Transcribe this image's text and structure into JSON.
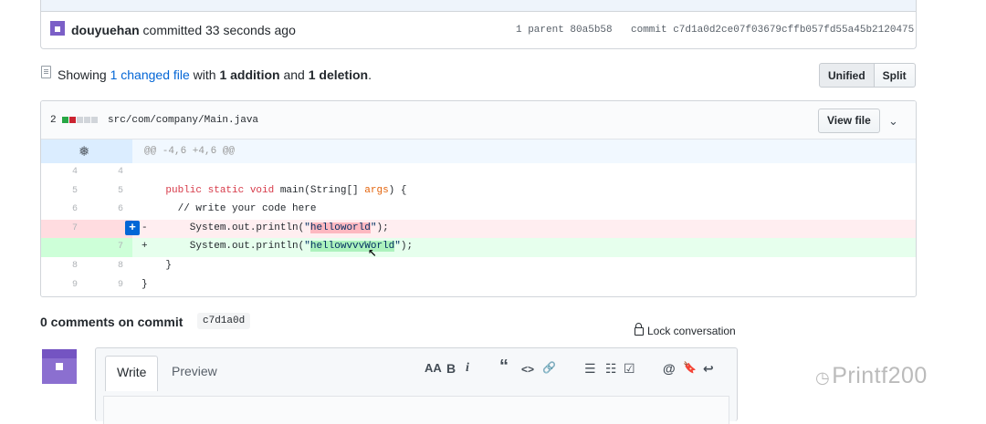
{
  "commit": {
    "author": "douyuehan",
    "action": " committed 33 seconds ago",
    "parent": "1 parent 80a5b58",
    "sha": "commit c7d1a0d2ce07f03679cffb057fd55a45b2120475"
  },
  "summary": {
    "prefix": "Showing ",
    "changed": "1 changed file",
    "mid1": " with ",
    "additions": "1 addition",
    "mid2": " and ",
    "deletions": "1 deletion",
    "suffix": "."
  },
  "view_buttons": {
    "unified": "Unified",
    "split": "Split"
  },
  "file": {
    "count": "2",
    "path": "src/com/company/Main.java",
    "view_file": "View file",
    "hunk": "@@ -4,6 +4,6 @@",
    "lines": [
      {
        "old": "4",
        "new": "4",
        "kind": "ctx",
        "text": ""
      },
      {
        "old": "5",
        "new": "5",
        "kind": "ctx",
        "text": "    public static void main(String[] args) {"
      },
      {
        "old": "6",
        "new": "6",
        "kind": "ctx",
        "text": "      // write your code here"
      },
      {
        "old": "7",
        "new": "",
        "kind": "del",
        "text": "        System.out.println(\"helloworld\");"
      },
      {
        "old": "",
        "new": "7",
        "kind": "add",
        "text": "        System.out.println(\"hellowvvvWorld\");"
      },
      {
        "old": "8",
        "new": "8",
        "kind": "ctx",
        "text": "    }"
      },
      {
        "old": "9",
        "new": "9",
        "kind": "ctx",
        "text": "}"
      }
    ]
  },
  "comments": {
    "title": "0 comments on commit",
    "sha": "c7d1a0d",
    "lock": "Lock conversation"
  },
  "editor": {
    "write": "Write",
    "preview": "Preview",
    "toolbar": [
      "AA",
      "B",
      "i",
      "“",
      "<>",
      "🔗",
      "☰",
      "☷",
      "☑",
      "@",
      "🔖",
      "↩"
    ]
  },
  "watermark": "Printf200"
}
